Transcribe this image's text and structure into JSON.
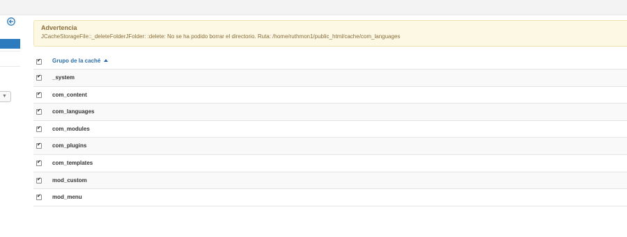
{
  "alert": {
    "title": "Advertencia",
    "message": "JCacheStorageFile::_deleteFolderJFolder: :delete: No se ha podido borrar el directorio. Ruta: /home/ruthmon1/public_html/cache/com_languages"
  },
  "table": {
    "header": "Grupo de la caché",
    "sort": "ascending",
    "rows": [
      {
        "name": "_system",
        "checked": true
      },
      {
        "name": "com_content",
        "checked": true
      },
      {
        "name": "com_languages",
        "checked": true
      },
      {
        "name": "com_modules",
        "checked": true
      },
      {
        "name": "com_plugins",
        "checked": true
      },
      {
        "name": "com_templates",
        "checked": true
      },
      {
        "name": "mod_custom",
        "checked": true
      },
      {
        "name": "mod_menu",
        "checked": true
      }
    ]
  },
  "colors": {
    "accent": "#2d7bbf",
    "alert_bg": "#fcf8e3",
    "alert_text": "#8a6d3b"
  },
  "icons": {
    "back": "circle-arrow-left-icon",
    "sort": "caret-up-icon",
    "dropdown": "caret-down-icon"
  }
}
